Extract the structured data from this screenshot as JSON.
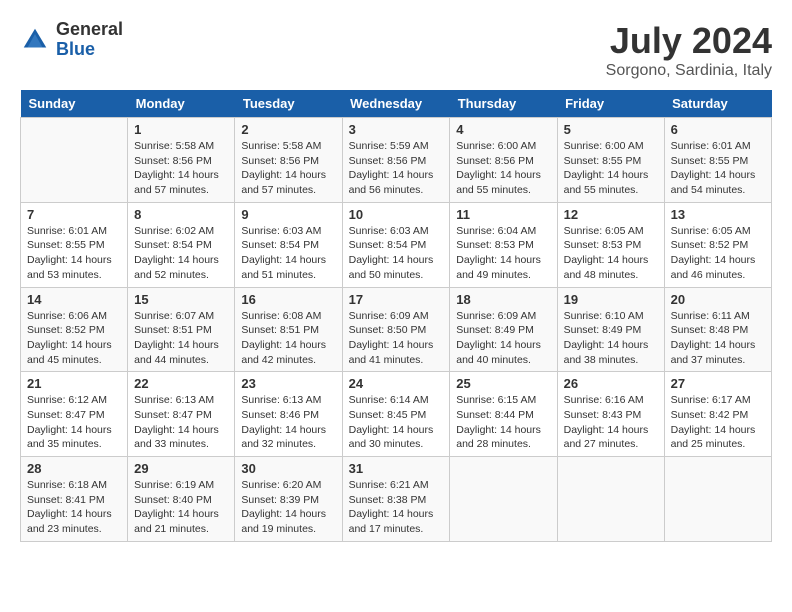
{
  "logo": {
    "general": "General",
    "blue": "Blue"
  },
  "title": {
    "month_year": "July 2024",
    "location": "Sorgono, Sardinia, Italy"
  },
  "days_of_week": [
    "Sunday",
    "Monday",
    "Tuesday",
    "Wednesday",
    "Thursday",
    "Friday",
    "Saturday"
  ],
  "weeks": [
    [
      {
        "day": "",
        "info": ""
      },
      {
        "day": "1",
        "info": "Sunrise: 5:58 AM\nSunset: 8:56 PM\nDaylight: 14 hours and 57 minutes."
      },
      {
        "day": "2",
        "info": "Sunrise: 5:58 AM\nSunset: 8:56 PM\nDaylight: 14 hours and 57 minutes."
      },
      {
        "day": "3",
        "info": "Sunrise: 5:59 AM\nSunset: 8:56 PM\nDaylight: 14 hours and 56 minutes."
      },
      {
        "day": "4",
        "info": "Sunrise: 6:00 AM\nSunset: 8:56 PM\nDaylight: 14 hours and 55 minutes."
      },
      {
        "day": "5",
        "info": "Sunrise: 6:00 AM\nSunset: 8:55 PM\nDaylight: 14 hours and 55 minutes."
      },
      {
        "day": "6",
        "info": "Sunrise: 6:01 AM\nSunset: 8:55 PM\nDaylight: 14 hours and 54 minutes."
      }
    ],
    [
      {
        "day": "7",
        "info": "Sunrise: 6:01 AM\nSunset: 8:55 PM\nDaylight: 14 hours and 53 minutes."
      },
      {
        "day": "8",
        "info": "Sunrise: 6:02 AM\nSunset: 8:54 PM\nDaylight: 14 hours and 52 minutes."
      },
      {
        "day": "9",
        "info": "Sunrise: 6:03 AM\nSunset: 8:54 PM\nDaylight: 14 hours and 51 minutes."
      },
      {
        "day": "10",
        "info": "Sunrise: 6:03 AM\nSunset: 8:54 PM\nDaylight: 14 hours and 50 minutes."
      },
      {
        "day": "11",
        "info": "Sunrise: 6:04 AM\nSunset: 8:53 PM\nDaylight: 14 hours and 49 minutes."
      },
      {
        "day": "12",
        "info": "Sunrise: 6:05 AM\nSunset: 8:53 PM\nDaylight: 14 hours and 48 minutes."
      },
      {
        "day": "13",
        "info": "Sunrise: 6:05 AM\nSunset: 8:52 PM\nDaylight: 14 hours and 46 minutes."
      }
    ],
    [
      {
        "day": "14",
        "info": "Sunrise: 6:06 AM\nSunset: 8:52 PM\nDaylight: 14 hours and 45 minutes."
      },
      {
        "day": "15",
        "info": "Sunrise: 6:07 AM\nSunset: 8:51 PM\nDaylight: 14 hours and 44 minutes."
      },
      {
        "day": "16",
        "info": "Sunrise: 6:08 AM\nSunset: 8:51 PM\nDaylight: 14 hours and 42 minutes."
      },
      {
        "day": "17",
        "info": "Sunrise: 6:09 AM\nSunset: 8:50 PM\nDaylight: 14 hours and 41 minutes."
      },
      {
        "day": "18",
        "info": "Sunrise: 6:09 AM\nSunset: 8:49 PM\nDaylight: 14 hours and 40 minutes."
      },
      {
        "day": "19",
        "info": "Sunrise: 6:10 AM\nSunset: 8:49 PM\nDaylight: 14 hours and 38 minutes."
      },
      {
        "day": "20",
        "info": "Sunrise: 6:11 AM\nSunset: 8:48 PM\nDaylight: 14 hours and 37 minutes."
      }
    ],
    [
      {
        "day": "21",
        "info": "Sunrise: 6:12 AM\nSunset: 8:47 PM\nDaylight: 14 hours and 35 minutes."
      },
      {
        "day": "22",
        "info": "Sunrise: 6:13 AM\nSunset: 8:47 PM\nDaylight: 14 hours and 33 minutes."
      },
      {
        "day": "23",
        "info": "Sunrise: 6:13 AM\nSunset: 8:46 PM\nDaylight: 14 hours and 32 minutes."
      },
      {
        "day": "24",
        "info": "Sunrise: 6:14 AM\nSunset: 8:45 PM\nDaylight: 14 hours and 30 minutes."
      },
      {
        "day": "25",
        "info": "Sunrise: 6:15 AM\nSunset: 8:44 PM\nDaylight: 14 hours and 28 minutes."
      },
      {
        "day": "26",
        "info": "Sunrise: 6:16 AM\nSunset: 8:43 PM\nDaylight: 14 hours and 27 minutes."
      },
      {
        "day": "27",
        "info": "Sunrise: 6:17 AM\nSunset: 8:42 PM\nDaylight: 14 hours and 25 minutes."
      }
    ],
    [
      {
        "day": "28",
        "info": "Sunrise: 6:18 AM\nSunset: 8:41 PM\nDaylight: 14 hours and 23 minutes."
      },
      {
        "day": "29",
        "info": "Sunrise: 6:19 AM\nSunset: 8:40 PM\nDaylight: 14 hours and 21 minutes."
      },
      {
        "day": "30",
        "info": "Sunrise: 6:20 AM\nSunset: 8:39 PM\nDaylight: 14 hours and 19 minutes."
      },
      {
        "day": "31",
        "info": "Sunrise: 6:21 AM\nSunset: 8:38 PM\nDaylight: 14 hours and 17 minutes."
      },
      {
        "day": "",
        "info": ""
      },
      {
        "day": "",
        "info": ""
      },
      {
        "day": "",
        "info": ""
      }
    ]
  ]
}
